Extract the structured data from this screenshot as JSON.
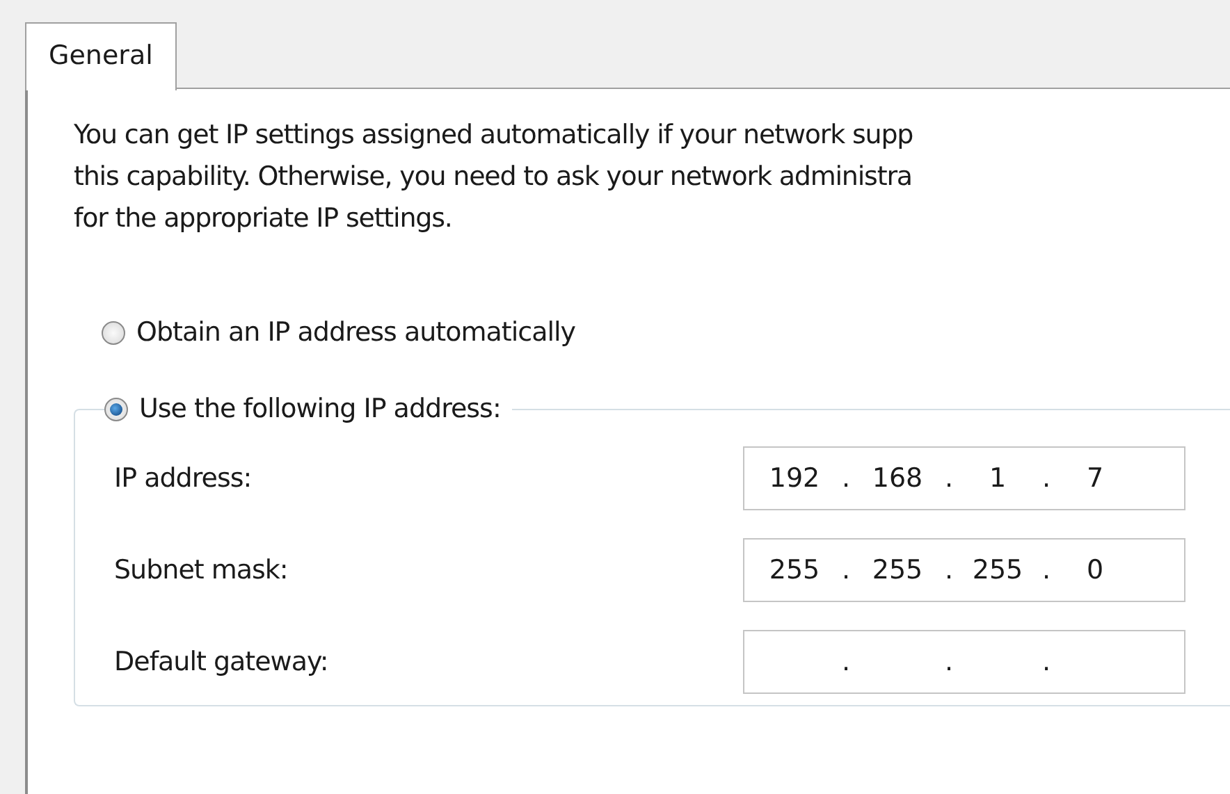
{
  "tabs": [
    {
      "label": "General",
      "selected": true
    }
  ],
  "intro_lines": [
    "You can get IP settings assigned automatically if your network supp",
    "this capability. Otherwise, you need to ask your network administra",
    "for the appropriate IP settings."
  ],
  "ip_options": [
    {
      "label": "Obtain an IP address automatically",
      "selected": false
    },
    {
      "label": "Use the following IP address:",
      "selected": true
    }
  ],
  "ip_fields": [
    {
      "label": "IP address:",
      "octets": [
        "192",
        "168",
        "1",
        "7"
      ],
      "separator": "."
    },
    {
      "label": "Subnet mask:",
      "octets": [
        "255",
        "255",
        "255",
        "0"
      ],
      "separator": "."
    },
    {
      "label": "Default gateway:",
      "separator": "."
    }
  ]
}
